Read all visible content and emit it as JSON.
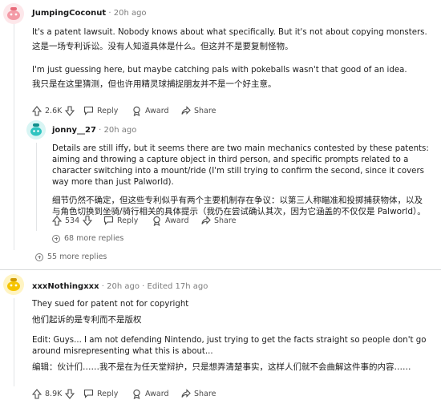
{
  "comments": [
    {
      "username": "JumpingCoconut",
      "time": "20h ago",
      "sep": "·",
      "paragraphs": [
        "It's a patent lawsuit. Nobody knows about what specifically. But it's not about copying monsters.",
        "这是一场专利诉讼。没有人知道具体是什么。但这并不是要复制怪物。",
        "I'm just guessing here, but maybe catching pals with pokeballs wasn't that good of an idea.",
        "我只是在这里猜测，但也许用精灵球捕捉朋友并不是一个好主意。"
      ],
      "votes": "2.6K",
      "reply_label": "Reply",
      "award_label": "Award",
      "share_label": "Share"
    },
    {
      "username": "jonny__27",
      "time": "20h ago",
      "sep": "·",
      "paragraphs": [
        "Details are still iffy, but it seems there are two main mechanics contested by these patents: aiming and throwing a capture object in third person, and specific prompts related to a character switching into a mount/ride (I'm still trying to confirm the second, since it covers way more than just Palworld).",
        "细节仍然不确定，但这些专利似乎有两个主要机制存在争议：以第三人称瞄准和投掷捕获物体，以及与角色切换到坐骑/骑行相关的具体提示（我仍在尝试确认其次，因为它涵盖的不仅仅是 Palworld）。"
      ],
      "votes": "534",
      "reply_label": "Reply",
      "award_label": "Award",
      "share_label": "Share",
      "more_replies": "68 more replies"
    },
    {
      "username": "xxxNothingxxx",
      "time": "20h ago",
      "edited": "Edited 17h ago",
      "sep": "·",
      "paragraphs": [
        "They sued for patent not for copyright",
        "他们起诉的是专利而不是版权",
        "Edit: Guys... I am not defending Nintendo, just trying to get the facts straight so people don't go around misrepresenting what this is about...",
        "编辑：伙计们……我不是在为任天堂辩护，只是想弄清楚事实，这样人们就不会曲解这件事的内容……"
      ],
      "votes": "8.9K",
      "reply_label": "Reply",
      "award_label": "Award",
      "share_label": "Share"
    }
  ],
  "thread_more_replies": "55 more replies",
  "colors": {
    "thread_line": "#e2e4e6",
    "avatar_pink": "#f7a8b0",
    "avatar_teal": "#2ec4c0",
    "avatar_yellow": "#f5c400"
  },
  "icons": [
    "upvote-icon",
    "downvote-icon",
    "reply-icon",
    "award-icon",
    "share-icon",
    "plus-circle-icon",
    "snoo-avatar-icon"
  ]
}
